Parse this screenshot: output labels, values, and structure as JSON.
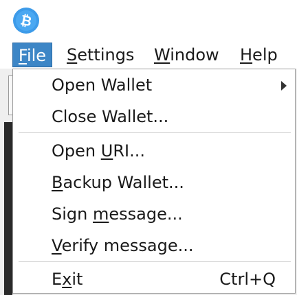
{
  "app": {
    "logo_icon": "bitcoin-logo-icon",
    "logo_color": "#3d9be9"
  },
  "menubar": {
    "file": {
      "mnemonic": "F",
      "rest": "ile"
    },
    "settings": {
      "mnemonic": "S",
      "rest": "ettings"
    },
    "window": {
      "mnemonic": "W",
      "rest": "indow"
    },
    "help": {
      "mnemonic": "H",
      "rest": "elp"
    }
  },
  "file_menu": {
    "open_wallet": {
      "before": "Open Wallet",
      "mnemonic": "",
      "after": ""
    },
    "close_wallet": {
      "before": "Close Wallet...",
      "mnemonic": "",
      "after": ""
    },
    "open_uri": {
      "before": "Open ",
      "mnemonic": "U",
      "after": "RI..."
    },
    "backup_wallet": {
      "before": "",
      "mnemonic": "B",
      "after": "ackup Wallet..."
    },
    "sign_message": {
      "before": "Sign ",
      "mnemonic": "m",
      "after": "essage..."
    },
    "verify_message": {
      "before": "",
      "mnemonic": "V",
      "after": "erify message..."
    },
    "exit": {
      "before": "E",
      "mnemonic": "x",
      "after": "it",
      "shortcut": "Ctrl+Q"
    }
  },
  "colors": {
    "menu_highlight": "#3d86c6",
    "menu_border": "#9c9c9c"
  }
}
